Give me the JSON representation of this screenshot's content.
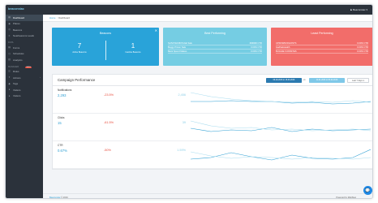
{
  "app": {
    "logo": "beaconstac"
  },
  "topbar": {
    "user": "♟ Beaconstac ▾"
  },
  "breadcrumb": {
    "home": "Home",
    "separator": "/",
    "current": "Dashboard"
  },
  "sidebar": {
    "items": [
      {
        "label": "Dashboard",
        "active": true
      },
      {
        "label": "Places"
      },
      {
        "label": "Beacons"
      },
      {
        "label": "Nearbeacons Leads"
      }
    ],
    "section_2": "DATA",
    "items_2": [
      {
        "label": "Forms"
      },
      {
        "label": "Schedules"
      },
      {
        "label": "Analytics"
      }
    ],
    "section_3": "MANAGER",
    "section_3_badge": "BETA",
    "items_3": [
      {
        "label": "Rules"
      },
      {
        "label": "Actions"
      },
      {
        "label": "Tags"
      },
      {
        "label": "Visitors"
      },
      {
        "label": "Visitors"
      }
    ]
  },
  "cards": {
    "beacons": {
      "title": "Beacons",
      "active_count": "7",
      "active_label": "Active Beacons",
      "inactive_count": "1",
      "inactive_label": "Inactive Beacons"
    },
    "best": {
      "title": "Best Performing",
      "rows": [
        {
          "name": "SHIVOSHSB PAGE Sale",
          "value": "###### CTR"
        },
        {
          "name": "Buggy Prison Sale",
          "value": "0.00% CTR"
        },
        {
          "name": "Bank Spend Makes",
          "value": "0.00% CTR"
        }
      ]
    },
    "least": {
      "title": "Least Performing",
      "rows": [
        {
          "name": "UPDOWNOKHOSTS",
          "value": "0.00% CTR"
        },
        {
          "name": "Gadhakstealth",
          "value": "0.00% CTR"
        },
        {
          "name": "BUGGIE FUNSSTES",
          "value": "0.00% CTR"
        }
      ]
    }
  },
  "campaign": {
    "title": "Campaign Performance",
    "date_a": "06-02-2016 to 15-03-2016",
    "vs": "vs",
    "date_b": "11-01-2016 to 05-02-2016",
    "range": "Last 7 days ▾",
    "metrics": [
      {
        "name": "Notifications",
        "value": "2,293",
        "change": "-23.5%",
        "prev": "2,456"
      },
      {
        "name": "Clicks",
        "value": "15",
        "change": "-61.5%",
        "prev": "39"
      },
      {
        "name": "CTR",
        "value": "0.67%",
        "change": "-50%",
        "prev": "1.59%"
      }
    ]
  },
  "footer": {
    "brand": "Beaconstac",
    "copyright": "© 2016",
    "powered": "Powered by MobStac"
  },
  "colors": {
    "sidebar_bg": "#2b323b",
    "card_blue": "#29a3d9",
    "card_teal": "#75cde3",
    "card_red": "#f26d6a",
    "accent": "#2e9fd3",
    "negative": "#e74c3c"
  },
  "icons": [
    "dashboard-icon",
    "places-icon",
    "beacon-icon",
    "leads-icon",
    "forms-icon",
    "schedules-icon",
    "analytics-icon",
    "rules-icon",
    "actions-icon",
    "tags-icon",
    "visitors-icon",
    "close-icon",
    "user-icon",
    "chat-icon"
  ]
}
